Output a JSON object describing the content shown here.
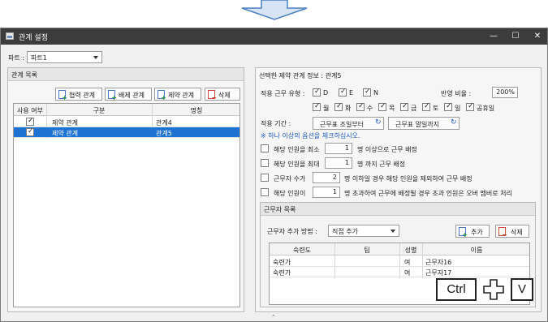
{
  "window": {
    "title": "관계 설정"
  },
  "part": {
    "label": "파트 :",
    "value": "파트1"
  },
  "left_panel": {
    "title": "관계 목록",
    "buttons": [
      "협력 관계",
      "배제 관계",
      "제약 관계",
      "삭제"
    ],
    "columns": [
      "사용 여부",
      "구분",
      "명칭"
    ],
    "rows": [
      {
        "checked": true,
        "type": "제약 관계",
        "name": "관계4",
        "selected": false
      },
      {
        "checked": true,
        "type": "제약 관계",
        "name": "관계5",
        "selected": true
      }
    ]
  },
  "right_panel": {
    "title": "선택한 제약 관계 정보 : 관계5",
    "work_type_label": "적용 근무 유형 :",
    "work_types": [
      "D",
      "E",
      "N"
    ],
    "ratio_label": "반영 비율 :",
    "ratio_value": "200%",
    "days": [
      "월",
      "화",
      "수",
      "목",
      "금",
      "토",
      "일",
      "공휴일"
    ],
    "period_label": "적용 기간 :",
    "period_start": "근무표 조일부터",
    "period_end": "근무표 말일까지",
    "note": "※ 하나 이상의 옵션을 체크하십시오.",
    "options": [
      {
        "prefix": "해당 인원을 최소",
        "value": "1",
        "suffix": "명 이상으로 근무 배정"
      },
      {
        "prefix": "해당 인원을 최대",
        "value": "1",
        "suffix": "명 까지 근무 배정"
      },
      {
        "prefix": "근무자 수가",
        "value": "2",
        "suffix": "명 이하일 경우 해당 인원을 제외하여 근무 배정"
      },
      {
        "prefix": "해당 인원이",
        "value": "1",
        "suffix": "명 초과하여 근무에 배정될 경우 초과 인원은 오버 멤버로 처리"
      }
    ],
    "workers": {
      "title": "근무자 목록",
      "add_method_label": "근무자 추가 방법 :",
      "add_method_value": "직접 추가",
      "add_button": "추가",
      "delete_button": "삭제",
      "columns": [
        "숙련도",
        "팀",
        "성별",
        "이름"
      ],
      "rows": [
        {
          "skill": "숙련가",
          "team": "",
          "gender": "여",
          "name": "근무자16"
        },
        {
          "skill": "숙련가",
          "team": "",
          "gender": "여",
          "name": "근무자17"
        }
      ]
    }
  },
  "overlay": {
    "key1": "Ctrl",
    "key2": "V"
  }
}
